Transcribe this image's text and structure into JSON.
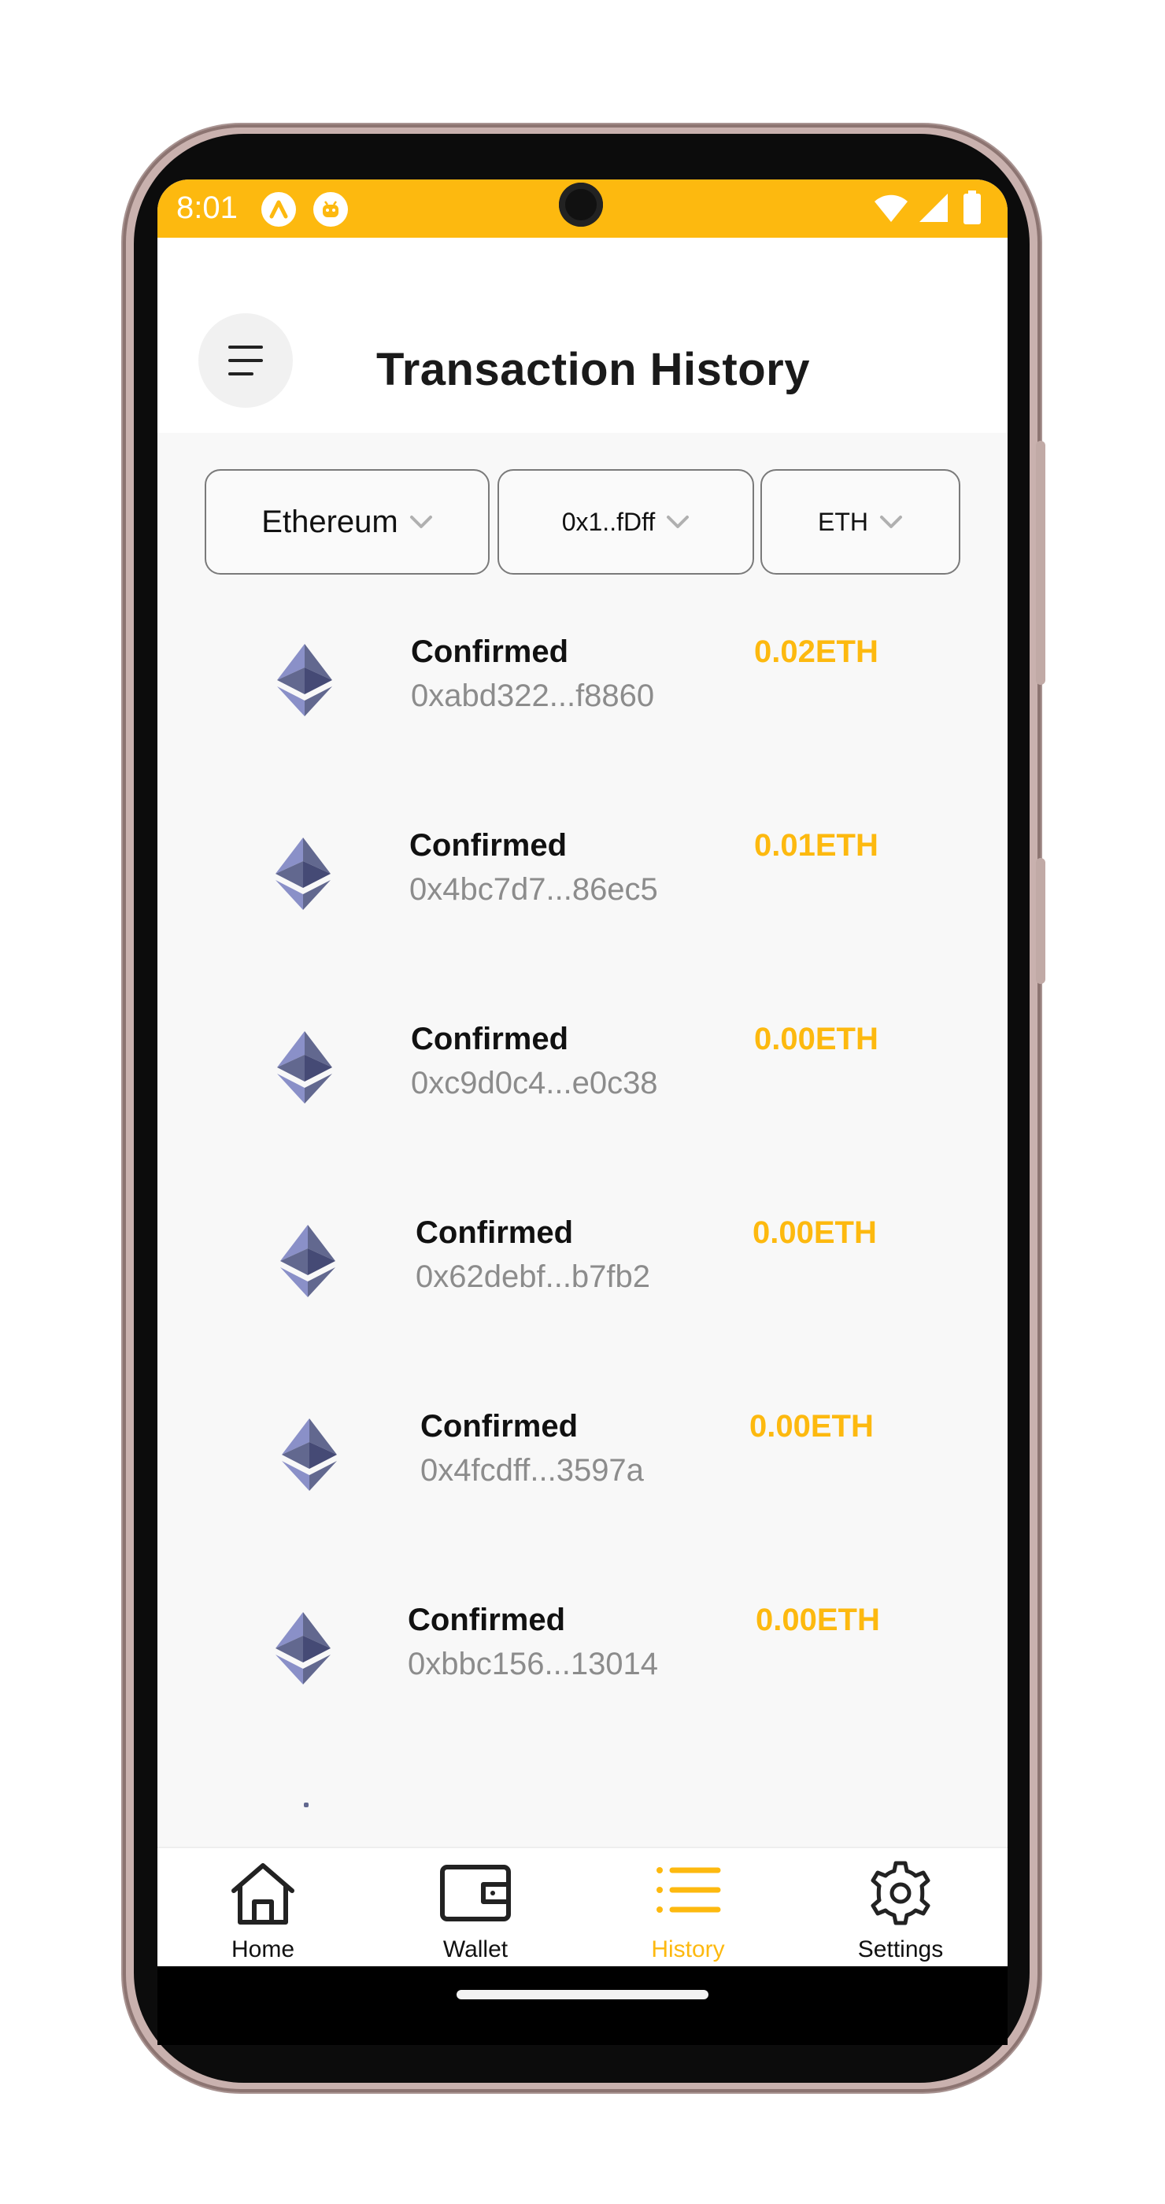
{
  "status_bar": {
    "time": "8:01",
    "app_icons": [
      "app-a-icon",
      "android-robot-icon"
    ],
    "system_icons": [
      "wifi-icon",
      "cell-signal-icon",
      "battery-icon"
    ]
  },
  "header": {
    "title": "Transaction History",
    "menu_icon": "hamburger-menu-icon"
  },
  "filters": {
    "network": "Ethereum",
    "address": "0x1..fDff",
    "token": "ETH"
  },
  "transactions": [
    {
      "status": "Confirmed",
      "hash": "0xabd322...f8860",
      "amount": "0.02ETH"
    },
    {
      "status": "Confirmed",
      "hash": "0x4bc7d7...86ec5",
      "amount": "0.01ETH"
    },
    {
      "status": "Confirmed",
      "hash": "0xc9d0c4...e0c38",
      "amount": "0.00ETH"
    },
    {
      "status": "Confirmed",
      "hash": "0x62debf...b7fb2",
      "amount": "0.00ETH"
    },
    {
      "status": "Confirmed",
      "hash": "0x4fcdff...3597a",
      "amount": "0.00ETH"
    },
    {
      "status": "Confirmed",
      "hash": "0xbbc156...13014",
      "amount": "0.00ETH"
    }
  ],
  "bottom_nav": {
    "items": [
      {
        "label": "Home",
        "icon": "home-icon"
      },
      {
        "label": "Wallet",
        "icon": "wallet-icon"
      },
      {
        "label": "History",
        "icon": "list-icon",
        "active": true
      },
      {
        "label": "Settings",
        "icon": "gear-icon"
      }
    ]
  },
  "colors": {
    "accent": "#fdb90f",
    "text": "#111111",
    "muted": "#8c8c8c",
    "background": "#f8f8f8",
    "eth_logo": "#6b72a8"
  }
}
